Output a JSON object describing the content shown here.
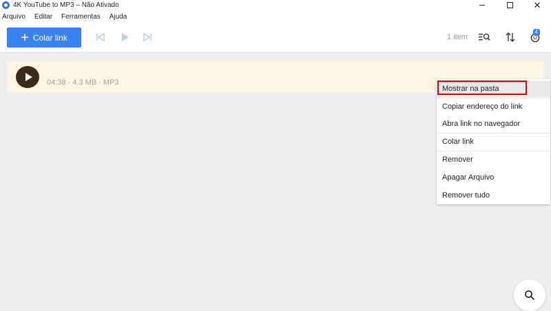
{
  "window": {
    "title": "4K YouTube to MP3 – Não Ativado"
  },
  "menu": {
    "items": [
      "Arquivo",
      "Editar",
      "Ferramentas",
      "Ajuda"
    ]
  },
  "toolbar": {
    "paste_label": "Colar link",
    "item_count": "1 item",
    "badge_count": "4"
  },
  "download": {
    "meta": "04:38 · 4,3 MB · MP3"
  },
  "context_menu": {
    "items": [
      "Mostrar na pasta",
      "Copiar endereço do link",
      "Abra link no navegador",
      "Colar link",
      "Remover",
      "Apagar Arquivo",
      "Remover tudo"
    ]
  },
  "colors": {
    "accent": "#3a82f0",
    "row_background": "#fdf6e4",
    "highlight_border": "#e00000",
    "app_background": "#efefef"
  },
  "icons": {
    "titlebar": "app-logo-icon",
    "toolbar": [
      "skip-previous-icon",
      "play-icon",
      "skip-next-icon",
      "search-list-icon",
      "sort-icon",
      "subscription-icon"
    ],
    "fab": "search-icon"
  }
}
